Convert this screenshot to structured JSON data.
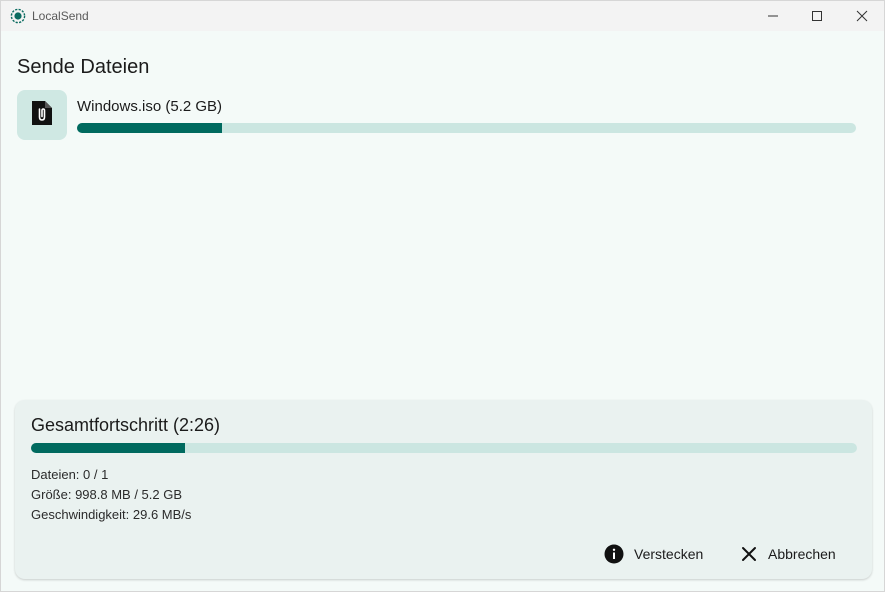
{
  "window": {
    "title": "LocalSend",
    "icons": {
      "app": "localsend-logo-icon",
      "minimize": "minimize-icon",
      "maximize": "maximize-icon",
      "close": "close-icon"
    }
  },
  "page": {
    "heading": "Sende Dateien"
  },
  "file": {
    "name": "Windows.iso (5.2 GB)",
    "icon": "file-attachment-icon",
    "progress_fraction": 0.186
  },
  "total": {
    "title": "Gesamtfortschritt (2:26)",
    "progress_fraction": 0.186,
    "files_text": "Dateien: 0 / 1",
    "size_text": "Größe: 998.8 MB / 5.2 GB",
    "speed_text": "Geschwindigkeit: 29.6 MB/s"
  },
  "actions": {
    "hide_label": "Verstecken",
    "hide_icon": "info-icon",
    "cancel_label": "Abbrechen",
    "cancel_icon": "close-icon"
  },
  "colors": {
    "accent": "#006a5f",
    "track": "#cbe6e1",
    "background": "#f4faf8"
  }
}
